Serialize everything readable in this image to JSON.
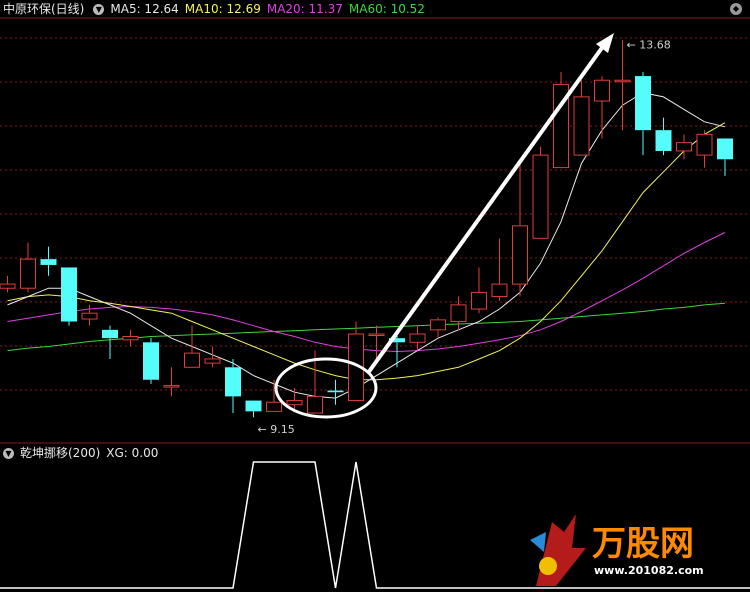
{
  "header": {
    "stock_name": "中原环保(日线)",
    "ma5_label": "MA5: 12.64",
    "ma10_label": "MA10: 12.69",
    "ma20_label": "MA20: 11.37",
    "ma60_label": "MA60: 10.52"
  },
  "indicator_header": {
    "name": "乾坤挪移(200)",
    "xg_label": "XG: 0.00"
  },
  "annotations": {
    "high_label": "13.68",
    "low_label": "9.15"
  },
  "watermark": {
    "brand": "万股网",
    "url": "www.201082.com"
  },
  "colors": {
    "up": "#e03c3c",
    "down": "#54fcfc",
    "ma5": "#e8e8e8",
    "ma10": "#f2f25a",
    "ma20": "#e040e0",
    "ma60": "#3cd83c",
    "grid": "#8a1a1a"
  },
  "chart_data": [
    {
      "type": "candlestick",
      "title": "中原环保(日线)",
      "ylim": [
        8.9,
        13.9
      ],
      "candles": [
        {
          "o": 10.7,
          "h": 10.85,
          "l": 10.65,
          "c": 10.75
        },
        {
          "o": 10.7,
          "h": 11.25,
          "l": 10.65,
          "c": 11.05
        },
        {
          "o": 11.05,
          "h": 11.2,
          "l": 10.85,
          "c": 10.98
        },
        {
          "o": 10.95,
          "h": 10.95,
          "l": 10.25,
          "c": 10.3
        },
        {
          "o": 10.33,
          "h": 10.5,
          "l": 10.25,
          "c": 10.4
        },
        {
          "o": 10.2,
          "h": 10.25,
          "l": 9.85,
          "c": 10.1
        },
        {
          "o": 10.08,
          "h": 10.2,
          "l": 10.0,
          "c": 10.12
        },
        {
          "o": 10.05,
          "h": 10.1,
          "l": 9.55,
          "c": 9.6
        },
        {
          "o": 9.53,
          "h": 9.75,
          "l": 9.4,
          "c": 9.53
        },
        {
          "o": 9.75,
          "h": 10.25,
          "l": 9.75,
          "c": 9.92
        },
        {
          "o": 9.8,
          "h": 10.0,
          "l": 9.75,
          "c": 9.85
        },
        {
          "o": 9.75,
          "h": 9.85,
          "l": 9.2,
          "c": 9.4
        },
        {
          "o": 9.35,
          "h": 9.35,
          "l": 9.15,
          "c": 9.22
        },
        {
          "o": 9.22,
          "h": 9.6,
          "l": 9.22,
          "c": 9.33
        },
        {
          "o": 9.3,
          "h": 9.5,
          "l": 9.25,
          "c": 9.35
        },
        {
          "o": 9.2,
          "h": 9.95,
          "l": 9.2,
          "c": 9.4
        },
        {
          "o": 9.47,
          "h": 9.6,
          "l": 9.3,
          "c": 9.45
        },
        {
          "o": 9.35,
          "h": 10.3,
          "l": 9.35,
          "c": 10.15
        },
        {
          "o": 10.15,
          "h": 10.25,
          "l": 9.8,
          "c": 10.15
        },
        {
          "o": 10.1,
          "h": 10.2,
          "l": 9.75,
          "c": 10.05
        },
        {
          "o": 10.05,
          "h": 10.25,
          "l": 9.95,
          "c": 10.15
        },
        {
          "o": 10.2,
          "h": 10.35,
          "l": 10.1,
          "c": 10.32
        },
        {
          "o": 10.3,
          "h": 10.6,
          "l": 10.2,
          "c": 10.5
        },
        {
          "o": 10.45,
          "h": 10.95,
          "l": 10.4,
          "c": 10.65
        },
        {
          "o": 10.6,
          "h": 11.3,
          "l": 10.55,
          "c": 10.75
        },
        {
          "o": 10.75,
          "h": 12.2,
          "l": 10.6,
          "c": 11.45
        },
        {
          "o": 11.3,
          "h": 12.4,
          "l": 11.3,
          "c": 12.3
        },
        {
          "o": 12.15,
          "h": 13.3,
          "l": 12.15,
          "c": 13.15
        },
        {
          "o": 12.3,
          "h": 13.2,
          "l": 12.3,
          "c": 13.0
        },
        {
          "o": 12.95,
          "h": 13.25,
          "l": 12.5,
          "c": 13.2
        },
        {
          "o": 13.2,
          "h": 13.68,
          "l": 12.6,
          "c": 13.2
        },
        {
          "o": 13.25,
          "h": 13.3,
          "l": 12.3,
          "c": 12.6
        },
        {
          "o": 12.6,
          "h": 12.75,
          "l": 12.3,
          "c": 12.35
        },
        {
          "o": 12.35,
          "h": 12.55,
          "l": 12.25,
          "c": 12.45
        },
        {
          "o": 12.3,
          "h": 12.6,
          "l": 12.15,
          "c": 12.55
        },
        {
          "o": 12.5,
          "h": 12.5,
          "l": 12.05,
          "c": 12.25
        }
      ],
      "ma5": [
        10.5,
        10.6,
        10.7,
        10.7,
        10.6,
        10.5,
        10.4,
        10.25,
        10.1,
        10.0,
        9.9,
        9.8,
        9.65,
        9.55,
        9.45,
        9.4,
        9.38,
        9.5,
        9.65,
        9.8,
        9.95,
        10.1,
        10.2,
        10.3,
        10.45,
        10.65,
        11.0,
        11.5,
        12.2,
        12.6,
        12.9,
        13.05,
        13.0,
        12.85,
        12.7,
        12.64
      ],
      "ma10": [
        10.55,
        10.6,
        10.62,
        10.6,
        10.55,
        10.52,
        10.48,
        10.44,
        10.4,
        10.3,
        10.2,
        10.1,
        10.0,
        9.9,
        9.8,
        9.72,
        9.65,
        9.6,
        9.6,
        9.62,
        9.65,
        9.7,
        9.75,
        9.85,
        9.95,
        10.1,
        10.3,
        10.55,
        10.85,
        11.15,
        11.5,
        11.85,
        12.1,
        12.35,
        12.55,
        12.69
      ],
      "ma20": [
        10.3,
        10.34,
        10.38,
        10.42,
        10.45,
        10.47,
        10.48,
        10.47,
        10.45,
        10.42,
        10.38,
        10.32,
        10.25,
        10.18,
        10.12,
        10.05,
        10.0,
        9.97,
        9.95,
        9.94,
        9.95,
        9.97,
        10.0,
        10.04,
        10.08,
        10.13,
        10.2,
        10.3,
        10.42,
        10.55,
        10.68,
        10.82,
        10.97,
        11.12,
        11.25,
        11.37
      ],
      "ma60": [
        9.95,
        9.98,
        10.0,
        10.03,
        10.06,
        10.08,
        10.1,
        10.12,
        10.13,
        10.14,
        10.15,
        10.16,
        10.17,
        10.18,
        10.19,
        10.2,
        10.21,
        10.22,
        10.23,
        10.24,
        10.25,
        10.26,
        10.27,
        10.28,
        10.29,
        10.3,
        10.32,
        10.34,
        10.36,
        10.38,
        10.4,
        10.42,
        10.45,
        10.47,
        10.5,
        10.52
      ]
    },
    {
      "type": "line",
      "title": "乾坤挪移(200)",
      "ylim": [
        0,
        1
      ],
      "x": [
        0,
        1,
        2,
        3,
        4,
        5,
        6,
        7,
        8,
        9,
        10,
        11,
        12,
        13,
        14,
        15,
        16,
        17,
        18,
        19,
        20,
        21,
        22,
        23,
        24,
        25,
        26,
        27,
        28,
        29,
        30,
        31,
        32,
        33,
        34,
        35
      ],
      "values": [
        0,
        0,
        0,
        0,
        0,
        0,
        0,
        0,
        0,
        0,
        0,
        0,
        1,
        1,
        1,
        1,
        0,
        1,
        0,
        0,
        0,
        0,
        0,
        0,
        0,
        0,
        0,
        0,
        0,
        0,
        0,
        0,
        0,
        0,
        0,
        0
      ]
    }
  ]
}
